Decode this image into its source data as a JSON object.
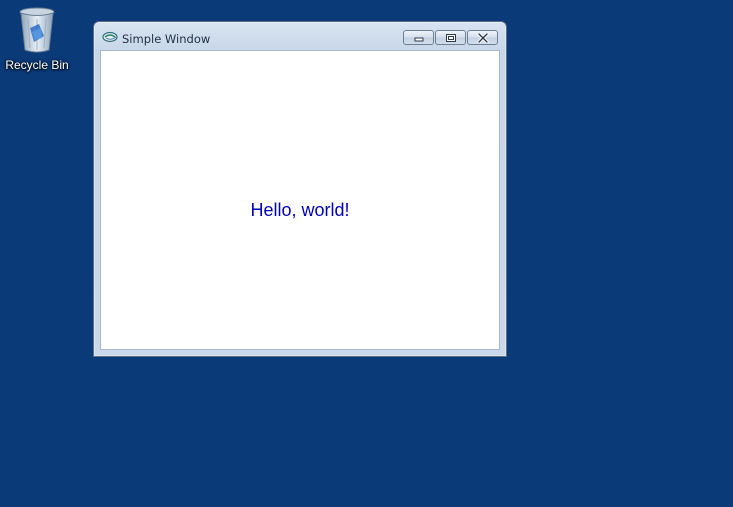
{
  "desktop": {
    "background_color": "#0b3a78",
    "icons": [
      {
        "label": "Recycle Bin",
        "icon": "recycle-bin-icon"
      }
    ]
  },
  "window": {
    "title": "Simple Window",
    "app_icon": "app-icon",
    "buttons": {
      "minimize_icon": "minimize-icon",
      "maximize_icon": "maximize-icon",
      "close_icon": "close-icon"
    },
    "content": {
      "message": "Hello, world!",
      "message_color": "#0000b4"
    }
  }
}
